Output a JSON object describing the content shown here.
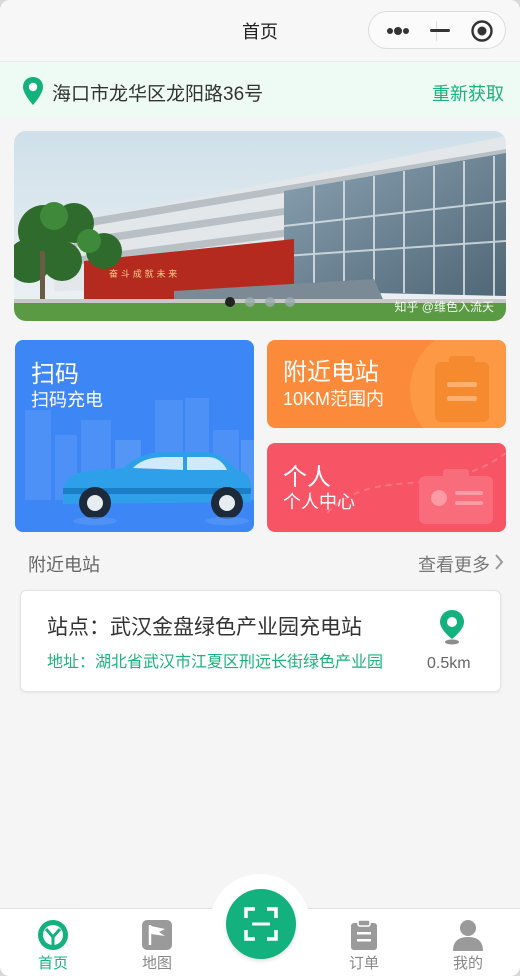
{
  "navbar": {
    "title": "首页"
  },
  "location": {
    "address": "海口市龙华区龙阳路36号",
    "refresh_label": "重新获取"
  },
  "banner": {
    "watermark": "知乎 @维色入流天",
    "slide_count": 4,
    "active_slide": 0
  },
  "cards": {
    "scan": {
      "title": "扫码",
      "subtitle": "扫码充电"
    },
    "nearby": {
      "title": "附近电站",
      "subtitle": "10KM范围内"
    },
    "profile": {
      "title": "个人",
      "subtitle": "个人中心"
    }
  },
  "nearby_section": {
    "title": "附近电站",
    "more_label": "查看更多"
  },
  "stations": [
    {
      "name": "站点：武汉金盘绿色产业园充电站",
      "address": "地址：湖北省武汉市江夏区刑远长街绿色产业园",
      "distance": "0.5km"
    }
  ],
  "tabbar": {
    "items": [
      {
        "label": "首页",
        "icon": "home-icon",
        "active": true
      },
      {
        "label": "地图",
        "icon": "map-icon",
        "active": false
      },
      {
        "label": "订单",
        "icon": "order-icon",
        "active": false
      },
      {
        "label": "我的",
        "icon": "user-icon",
        "active": false
      }
    ]
  },
  "colors": {
    "accent": "#19b37b",
    "scan_card": "#3d86f5",
    "nearby_card": "#fb8b3a",
    "profile_card": "#f75466"
  }
}
